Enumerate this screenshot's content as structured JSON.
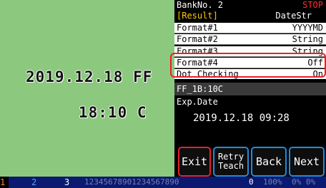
{
  "image": {
    "ocr_date": "2019.12.18 FF",
    "ocr_time": "18:10 C"
  },
  "panel": {
    "bank_no": "BankNo. 2",
    "status": "STOP",
    "result_label": "[Result]",
    "result_mode": "DateStr",
    "rows": [
      {
        "label": "Format#1",
        "value": "YYYYMD"
      },
      {
        "label": "Format#2",
        "value": "String"
      },
      {
        "label": "Format#3",
        "value": "String"
      },
      {
        "label": "Format#4",
        "value": "Off"
      },
      {
        "label": "Dot Checking",
        "value": "On"
      }
    ],
    "inspection_code": "FF_1B:10C",
    "exp_label": "Exp.Date",
    "exp_value": "2019.12.18  09:28"
  },
  "buttons": {
    "exit": "Exit",
    "retry_line1": "Retry",
    "retry_line2": "Teach",
    "back": "Back",
    "next": "Next"
  },
  "status_bar": {
    "bank1": "1",
    "bank2": "2",
    "bank3": "3",
    "digits": "12345678901234567890",
    "count": "0",
    "percent": "100%",
    "tail": "0%  0%"
  },
  "colors": {
    "stop": "#ff3030",
    "result": "#ffc800",
    "highlight": "#e8202a",
    "button_border": "#1e8ce0",
    "image_bg": "#8cc97e"
  }
}
